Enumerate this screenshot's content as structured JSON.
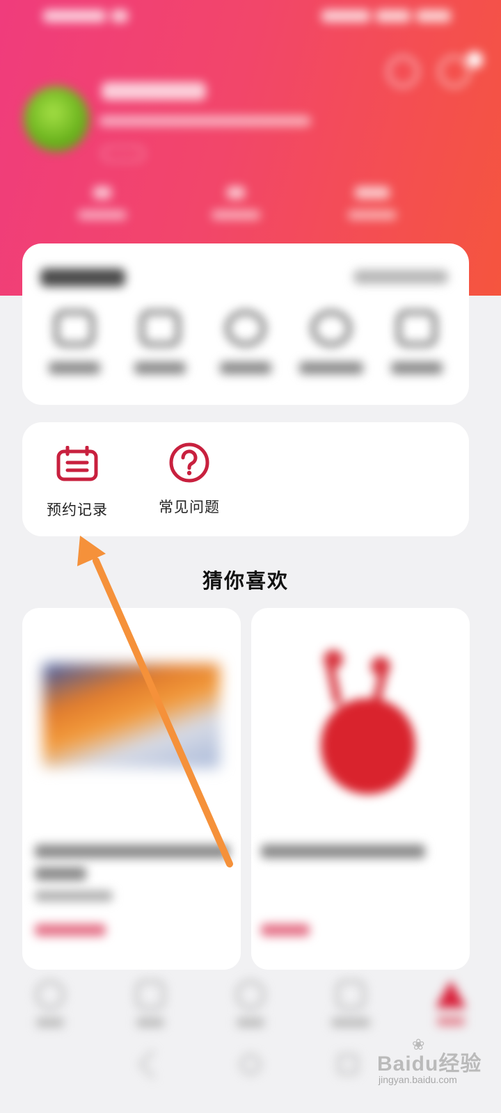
{
  "service": {
    "items": [
      {
        "label": "预约记录",
        "icon": "calendar-list-icon"
      },
      {
        "label": "常见问题",
        "icon": "question-circle-icon"
      }
    ]
  },
  "recommend": {
    "title": "猜你喜欢"
  },
  "watermark": {
    "brand": "Baidu经验",
    "url": "jingyan.baidu.com"
  },
  "colors": {
    "header_start": "#f03c7c",
    "header_end": "#f5553e",
    "icon_accent": "#c8203e",
    "arrow": "#f5913a"
  }
}
